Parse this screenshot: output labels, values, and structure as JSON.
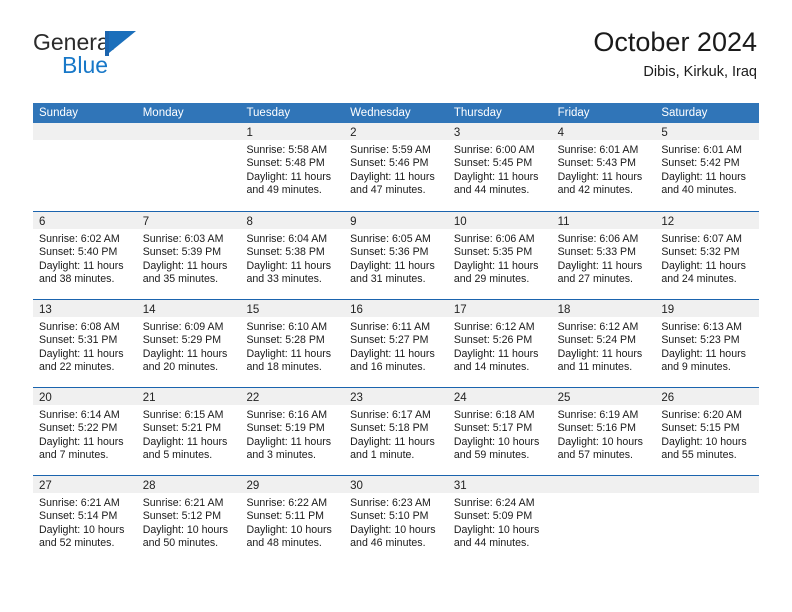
{
  "brand": {
    "name_top": "General",
    "name_bottom": "Blue",
    "mark": "triangle-logo"
  },
  "header": {
    "title": "October 2024",
    "subtitle": "Dibis, Kirkuk, Iraq"
  },
  "colors": {
    "header_blue": "#3075b8",
    "row_rule": "#1b64ae",
    "day_band": "#f0f0f0",
    "brand_blue": "#1878c8"
  },
  "weekdays": [
    "Sunday",
    "Monday",
    "Tuesday",
    "Wednesday",
    "Thursday",
    "Friday",
    "Saturday"
  ],
  "weeks": [
    [
      {
        "day": "",
        "lines": []
      },
      {
        "day": "",
        "lines": []
      },
      {
        "day": "1",
        "lines": [
          "Sunrise: 5:58 AM",
          "Sunset: 5:48 PM",
          "Daylight: 11 hours",
          "and 49 minutes."
        ]
      },
      {
        "day": "2",
        "lines": [
          "Sunrise: 5:59 AM",
          "Sunset: 5:46 PM",
          "Daylight: 11 hours",
          "and 47 minutes."
        ]
      },
      {
        "day": "3",
        "lines": [
          "Sunrise: 6:00 AM",
          "Sunset: 5:45 PM",
          "Daylight: 11 hours",
          "and 44 minutes."
        ]
      },
      {
        "day": "4",
        "lines": [
          "Sunrise: 6:01 AM",
          "Sunset: 5:43 PM",
          "Daylight: 11 hours",
          "and 42 minutes."
        ]
      },
      {
        "day": "5",
        "lines": [
          "Sunrise: 6:01 AM",
          "Sunset: 5:42 PM",
          "Daylight: 11 hours",
          "and 40 minutes."
        ]
      }
    ],
    [
      {
        "day": "6",
        "lines": [
          "Sunrise: 6:02 AM",
          "Sunset: 5:40 PM",
          "Daylight: 11 hours",
          "and 38 minutes."
        ]
      },
      {
        "day": "7",
        "lines": [
          "Sunrise: 6:03 AM",
          "Sunset: 5:39 PM",
          "Daylight: 11 hours",
          "and 35 minutes."
        ]
      },
      {
        "day": "8",
        "lines": [
          "Sunrise: 6:04 AM",
          "Sunset: 5:38 PM",
          "Daylight: 11 hours",
          "and 33 minutes."
        ]
      },
      {
        "day": "9",
        "lines": [
          "Sunrise: 6:05 AM",
          "Sunset: 5:36 PM",
          "Daylight: 11 hours",
          "and 31 minutes."
        ]
      },
      {
        "day": "10",
        "lines": [
          "Sunrise: 6:06 AM",
          "Sunset: 5:35 PM",
          "Daylight: 11 hours",
          "and 29 minutes."
        ]
      },
      {
        "day": "11",
        "lines": [
          "Sunrise: 6:06 AM",
          "Sunset: 5:33 PM",
          "Daylight: 11 hours",
          "and 27 minutes."
        ]
      },
      {
        "day": "12",
        "lines": [
          "Sunrise: 6:07 AM",
          "Sunset: 5:32 PM",
          "Daylight: 11 hours",
          "and 24 minutes."
        ]
      }
    ],
    [
      {
        "day": "13",
        "lines": [
          "Sunrise: 6:08 AM",
          "Sunset: 5:31 PM",
          "Daylight: 11 hours",
          "and 22 minutes."
        ]
      },
      {
        "day": "14",
        "lines": [
          "Sunrise: 6:09 AM",
          "Sunset: 5:29 PM",
          "Daylight: 11 hours",
          "and 20 minutes."
        ]
      },
      {
        "day": "15",
        "lines": [
          "Sunrise: 6:10 AM",
          "Sunset: 5:28 PM",
          "Daylight: 11 hours",
          "and 18 minutes."
        ]
      },
      {
        "day": "16",
        "lines": [
          "Sunrise: 6:11 AM",
          "Sunset: 5:27 PM",
          "Daylight: 11 hours",
          "and 16 minutes."
        ]
      },
      {
        "day": "17",
        "lines": [
          "Sunrise: 6:12 AM",
          "Sunset: 5:26 PM",
          "Daylight: 11 hours",
          "and 14 minutes."
        ]
      },
      {
        "day": "18",
        "lines": [
          "Sunrise: 6:12 AM",
          "Sunset: 5:24 PM",
          "Daylight: 11 hours",
          "and 11 minutes."
        ]
      },
      {
        "day": "19",
        "lines": [
          "Sunrise: 6:13 AM",
          "Sunset: 5:23 PM",
          "Daylight: 11 hours",
          "and 9 minutes."
        ]
      }
    ],
    [
      {
        "day": "20",
        "lines": [
          "Sunrise: 6:14 AM",
          "Sunset: 5:22 PM",
          "Daylight: 11 hours",
          "and 7 minutes."
        ]
      },
      {
        "day": "21",
        "lines": [
          "Sunrise: 6:15 AM",
          "Sunset: 5:21 PM",
          "Daylight: 11 hours",
          "and 5 minutes."
        ]
      },
      {
        "day": "22",
        "lines": [
          "Sunrise: 6:16 AM",
          "Sunset: 5:19 PM",
          "Daylight: 11 hours",
          "and 3 minutes."
        ]
      },
      {
        "day": "23",
        "lines": [
          "Sunrise: 6:17 AM",
          "Sunset: 5:18 PM",
          "Daylight: 11 hours",
          "and 1 minute."
        ]
      },
      {
        "day": "24",
        "lines": [
          "Sunrise: 6:18 AM",
          "Sunset: 5:17 PM",
          "Daylight: 10 hours",
          "and 59 minutes."
        ]
      },
      {
        "day": "25",
        "lines": [
          "Sunrise: 6:19 AM",
          "Sunset: 5:16 PM",
          "Daylight: 10 hours",
          "and 57 minutes."
        ]
      },
      {
        "day": "26",
        "lines": [
          "Sunrise: 6:20 AM",
          "Sunset: 5:15 PM",
          "Daylight: 10 hours",
          "and 55 minutes."
        ]
      }
    ],
    [
      {
        "day": "27",
        "lines": [
          "Sunrise: 6:21 AM",
          "Sunset: 5:14 PM",
          "Daylight: 10 hours",
          "and 52 minutes."
        ]
      },
      {
        "day": "28",
        "lines": [
          "Sunrise: 6:21 AM",
          "Sunset: 5:12 PM",
          "Daylight: 10 hours",
          "and 50 minutes."
        ]
      },
      {
        "day": "29",
        "lines": [
          "Sunrise: 6:22 AM",
          "Sunset: 5:11 PM",
          "Daylight: 10 hours",
          "and 48 minutes."
        ]
      },
      {
        "day": "30",
        "lines": [
          "Sunrise: 6:23 AM",
          "Sunset: 5:10 PM",
          "Daylight: 10 hours",
          "and 46 minutes."
        ]
      },
      {
        "day": "31",
        "lines": [
          "Sunrise: 6:24 AM",
          "Sunset: 5:09 PM",
          "Daylight: 10 hours",
          "and 44 minutes."
        ]
      },
      {
        "day": "",
        "lines": []
      },
      {
        "day": "",
        "lines": []
      }
    ]
  ]
}
